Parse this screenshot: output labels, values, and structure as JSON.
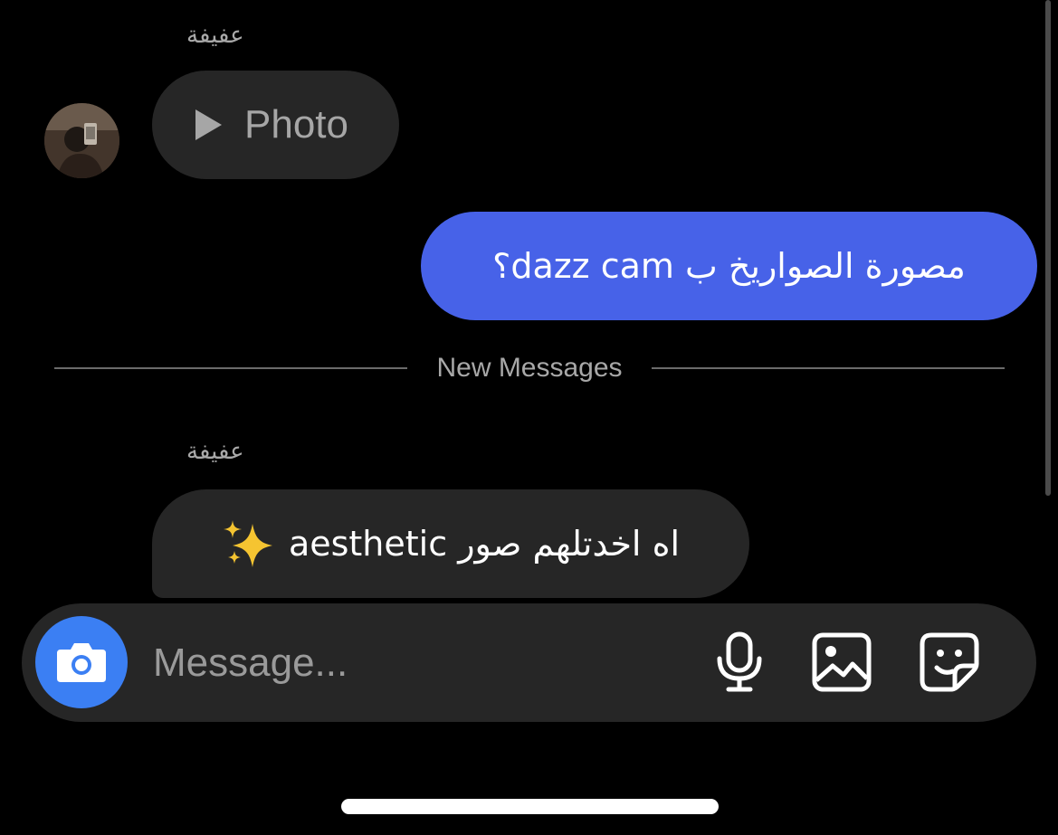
{
  "conversation": {
    "messages": [
      {
        "sender": "عفيفة",
        "direction": "incoming",
        "type": "video",
        "label": "Photo"
      },
      {
        "direction": "outgoing",
        "text": "مصورة الصواريخ ب dazz cam؟"
      },
      {
        "sender": "عفيفة",
        "direction": "incoming",
        "type": "text",
        "text": "اه اخدتلهم صور aesthetic",
        "emoji_icon": "sparkles-icon"
      }
    ],
    "divider_label": "New Messages"
  },
  "composer": {
    "placeholder": "Message...",
    "icons": [
      "camera-icon",
      "microphone-icon",
      "gallery-icon",
      "sticker-icon"
    ]
  },
  "colors": {
    "background": "#000000",
    "incoming_bubble": "#262626",
    "outgoing_bubble": "#4762e8",
    "camera_button": "#3b7ff3",
    "secondary_text": "#a8a8a8"
  }
}
